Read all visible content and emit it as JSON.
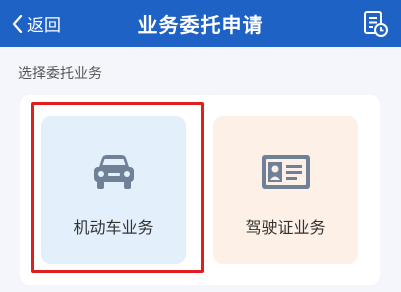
{
  "header": {
    "back_label": "返回",
    "title": "业务委托申请"
  },
  "section": {
    "label": "选择委托业务"
  },
  "cards": {
    "vehicle": {
      "label": "机动车业务",
      "icon": "car-icon"
    },
    "license": {
      "label": "驾驶证业务",
      "icon": "id-card-icon"
    }
  },
  "colors": {
    "header_bg": "#1e62c6",
    "vehicle_card_bg": "#e3f0fb",
    "license_card_bg": "#fdf0e6",
    "icon_color": "#6f8097",
    "highlight": "#e01e1e"
  }
}
